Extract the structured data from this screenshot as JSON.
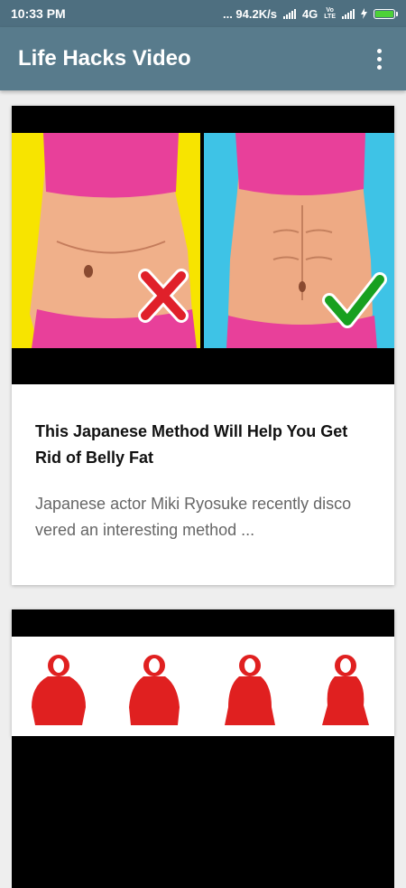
{
  "status_bar": {
    "time": "10:33 PM",
    "network_speed": "... 94.2K/s",
    "network_type": "4G",
    "volte": "Vo LTE",
    "battery_color": "#4cd137"
  },
  "toolbar": {
    "title": "Life Hacks Video",
    "menu_icon": "more-vert-icon"
  },
  "videos": [
    {
      "thumbnail": "belly-fat-comparison-thumbnail",
      "title": "This Japanese Method Will Help You Get Rid of Belly Fat",
      "description": "Japanese actor Miki Ryosuke recently disco vered an interesting method ..."
    },
    {
      "thumbnail": "body-shapes-thumbnail"
    }
  ],
  "colors": {
    "status_bar": "#4e6f80",
    "toolbar": "#587b8c",
    "background": "#eeeeee"
  }
}
